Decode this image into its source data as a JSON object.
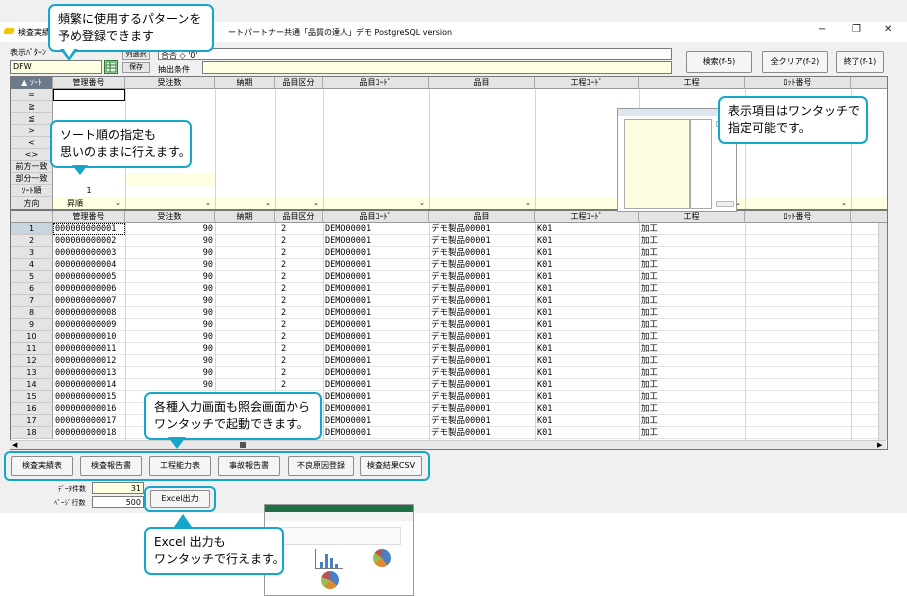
{
  "window": {
    "title_left": "検査実績",
    "title_right": "ートパートナー共通「品質の達人」デモ PostgreSQL version",
    "minimize": "−",
    "restore": "❐",
    "close": "✕"
  },
  "toolbar": {
    "pattern_label": "表示ﾊﾟﾀｰﾝ",
    "pattern_value": "DFW",
    "col_select_label": "列選択",
    "save_label": "保存",
    "condition_label": "抽出条件",
    "condition_value": "合否 ◇ '0'",
    "search_button": "検索(f-5)",
    "clear_button": "全クリア(f-2)",
    "exit_button": "終了(f-1)"
  },
  "filter_grid": {
    "sort_toggle": "▲ ｿｰﾄ",
    "columns": [
      "管理番号",
      "受注数",
      "納期",
      "品目区分",
      "品目ｺｰﾄﾞ",
      "品目",
      "工程ｺｰﾄﾞ",
      "工程",
      "ﾛｯﾄ番号"
    ],
    "row_labels": [
      "=",
      "≧",
      "≦",
      ">",
      "<",
      "<>",
      "前方一致",
      "部分一致",
      "ｿｰﾄ順",
      "方向"
    ],
    "sort_order_value": "1",
    "direction_value": "昇順"
  },
  "data_grid": {
    "columns": [
      "管理番号",
      "受注数",
      "納期",
      "品目区分",
      "品目ｺｰﾄﾞ",
      "品目",
      "工程ｺｰﾄﾞ",
      "工程",
      "ﾛｯﾄ番号"
    ],
    "rows": [
      {
        "no": "1",
        "id": "000000000001",
        "qty": "90",
        "cls": "2",
        "code": "DEMO00001",
        "item": "デモ製品00001",
        "proc_code": "K01",
        "proc": "加工"
      },
      {
        "no": "2",
        "id": "000000000002",
        "qty": "90",
        "cls": "2",
        "code": "DEMO00001",
        "item": "デモ製品00001",
        "proc_code": "K01",
        "proc": "加工"
      },
      {
        "no": "3",
        "id": "000000000003",
        "qty": "90",
        "cls": "2",
        "code": "DEMO00001",
        "item": "デモ製品00001",
        "proc_code": "K01",
        "proc": "加工"
      },
      {
        "no": "4",
        "id": "000000000004",
        "qty": "90",
        "cls": "2",
        "code": "DEMO00001",
        "item": "デモ製品00001",
        "proc_code": "K01",
        "proc": "加工"
      },
      {
        "no": "5",
        "id": "000000000005",
        "qty": "90",
        "cls": "2",
        "code": "DEMO00001",
        "item": "デモ製品00001",
        "proc_code": "K01",
        "proc": "加工"
      },
      {
        "no": "6",
        "id": "000000000006",
        "qty": "90",
        "cls": "2",
        "code": "DEMO00001",
        "item": "デモ製品00001",
        "proc_code": "K01",
        "proc": "加工"
      },
      {
        "no": "7",
        "id": "000000000007",
        "qty": "90",
        "cls": "2",
        "code": "DEMO00001",
        "item": "デモ製品00001",
        "proc_code": "K01",
        "proc": "加工"
      },
      {
        "no": "8",
        "id": "000000000008",
        "qty": "90",
        "cls": "2",
        "code": "DEMO00001",
        "item": "デモ製品00001",
        "proc_code": "K01",
        "proc": "加工"
      },
      {
        "no": "9",
        "id": "000000000009",
        "qty": "90",
        "cls": "2",
        "code": "DEMO00001",
        "item": "デモ製品00001",
        "proc_code": "K01",
        "proc": "加工"
      },
      {
        "no": "10",
        "id": "000000000010",
        "qty": "90",
        "cls": "2",
        "code": "DEMO00001",
        "item": "デモ製品00001",
        "proc_code": "K01",
        "proc": "加工"
      },
      {
        "no": "11",
        "id": "000000000011",
        "qty": "90",
        "cls": "2",
        "code": "DEMO00001",
        "item": "デモ製品00001",
        "proc_code": "K01",
        "proc": "加工"
      },
      {
        "no": "12",
        "id": "000000000012",
        "qty": "90",
        "cls": "2",
        "code": "DEMO00001",
        "item": "デモ製品00001",
        "proc_code": "K01",
        "proc": "加工"
      },
      {
        "no": "13",
        "id": "000000000013",
        "qty": "90",
        "cls": "2",
        "code": "DEMO00001",
        "item": "デモ製品00001",
        "proc_code": "K01",
        "proc": "加工"
      },
      {
        "no": "14",
        "id": "000000000014",
        "qty": "90",
        "cls": "2",
        "code": "DEMO00001",
        "item": "デモ製品00001",
        "proc_code": "K01",
        "proc": "加工"
      },
      {
        "no": "15",
        "id": "000000000015",
        "qty": "90",
        "cls": "2",
        "code": "DEMO00001",
        "item": "デモ製品00001",
        "proc_code": "K01",
        "proc": "加工"
      },
      {
        "no": "16",
        "id": "000000000016",
        "qty": "90",
        "cls": "2",
        "code": "DEMO00001",
        "item": "デモ製品00001",
        "proc_code": "K01",
        "proc": "加工"
      },
      {
        "no": "17",
        "id": "000000000017",
        "qty": "90",
        "cls": "2",
        "code": "DEMO00001",
        "item": "デモ製品00001",
        "proc_code": "K01",
        "proc": "加工"
      },
      {
        "no": "18",
        "id": "000000000018",
        "qty": "90",
        "cls": "2",
        "code": "DEMO00001",
        "item": "デモ製品00001",
        "proc_code": "K01",
        "proc": "加工"
      }
    ]
  },
  "bottom_buttons": [
    "検査実績表",
    "検査報告書",
    "工程能力表",
    "事故報告書",
    "不良原因登録",
    "検査結果CSV"
  ],
  "footer": {
    "data_count_label": "ﾃﾞｰﾀ件数",
    "data_count_value": "31",
    "page_rows_label": "ﾍﾟｰｼﾞ行数",
    "page_rows_value": "500",
    "excel_button": "Excel出力"
  },
  "callouts": {
    "pattern": [
      "頻繁に使用するパターンを",
      "予め登録できます"
    ],
    "display_items": [
      "表示項目はワンタッチで",
      "指定可能です。"
    ],
    "sort": [
      "ソート順の指定も",
      "思いのままに行えます。"
    ],
    "screens": [
      "各種入力画面も照会画面から",
      "ワンタッチで起動できます。"
    ],
    "excel": [
      "Excel 出力も",
      "ワンタッチで行えます。"
    ]
  },
  "colors": {
    "callout_border": "#16a6c9",
    "input_bg": "#ffffe1"
  }
}
